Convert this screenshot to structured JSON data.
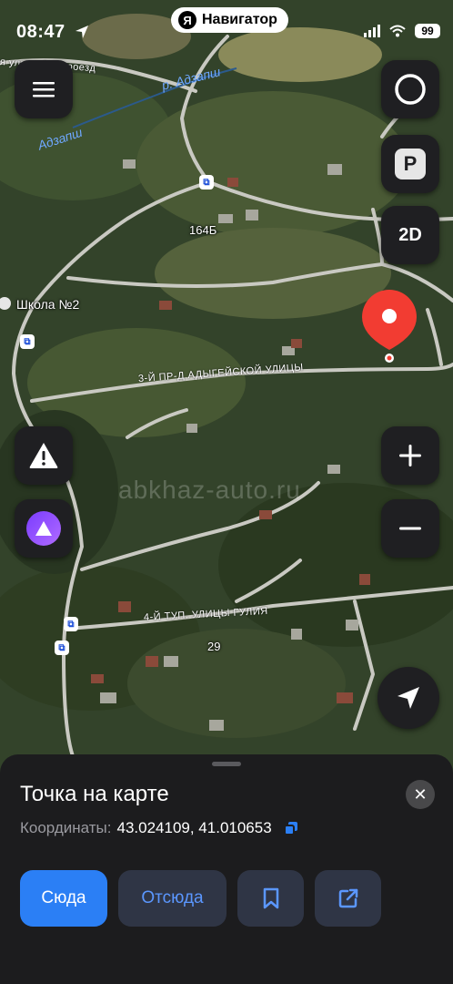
{
  "status_bar": {
    "time": "08:47",
    "app_name": "Навигатор",
    "app_logo": "Я",
    "battery": "99"
  },
  "map": {
    "labels": {
      "school": "Школа №2",
      "house_164b": "164Б",
      "house_29": "29",
      "street_top": "я улица 3-й проезд",
      "street_adygeyskaya": "3-Й ПР-Д АДЫГЕЙСКОЙ УЛИЦЫ",
      "street_gulia": "4-Й ТУП. УЛИЦЫ ГУЛИЯ",
      "river_1": "р. Адзапш",
      "river_2": "Адзапш"
    },
    "watermark": "abkhaz-auto.ru",
    "pin_color": "#f23c32"
  },
  "controls": {
    "two_d": "2D",
    "parking": "P"
  },
  "sheet": {
    "title": "Точка на карте",
    "coords_label": "Координаты:",
    "coords_value": "43.024109, 41.010653",
    "btn_here": "Сюда",
    "btn_from": "Отсюда"
  },
  "colors": {
    "accent": "#2b7ff5",
    "sheet_bg": "#1c1c1e"
  }
}
